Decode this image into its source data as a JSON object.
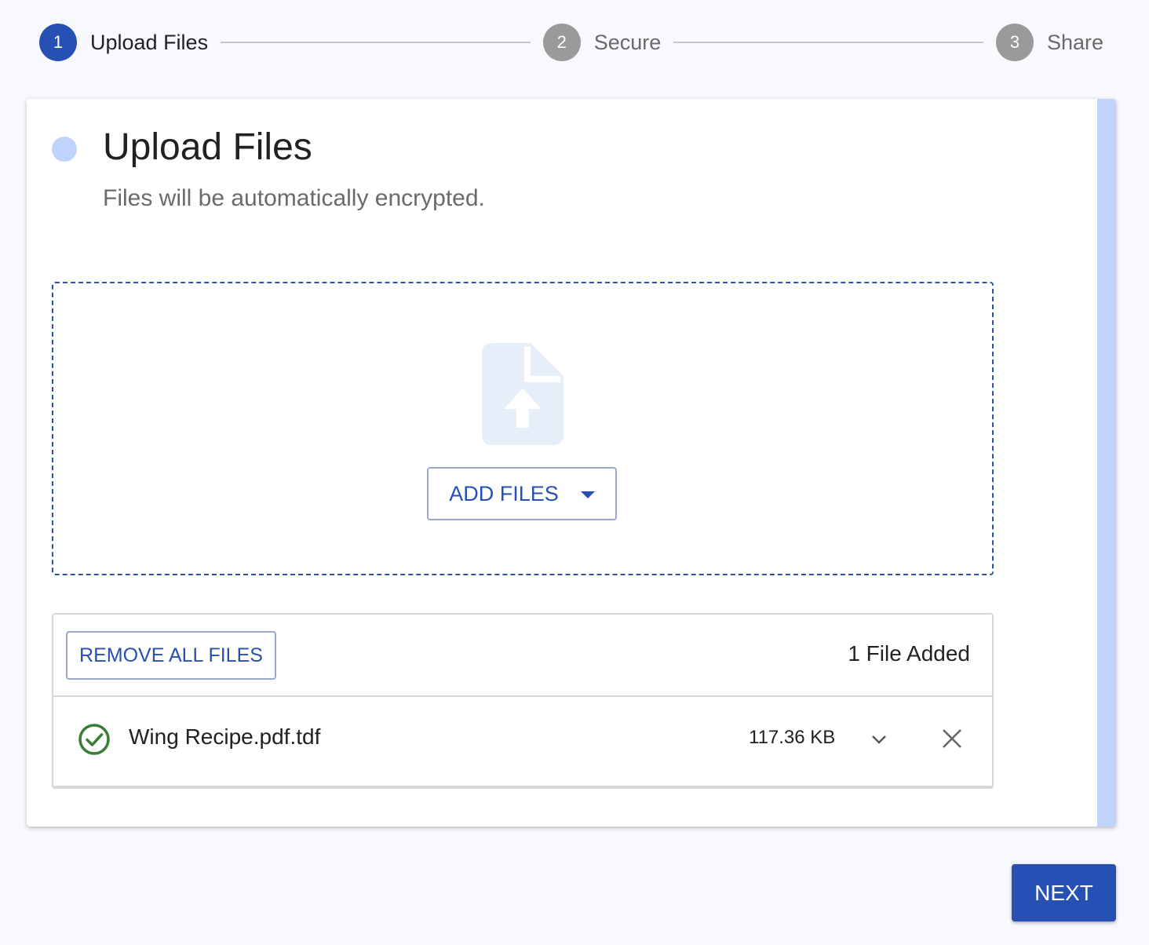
{
  "stepper": {
    "steps": [
      {
        "number": "1",
        "label": "Upload Files",
        "state": "active"
      },
      {
        "number": "2",
        "label": "Secure",
        "state": "inactive"
      },
      {
        "number": "3",
        "label": "Share",
        "state": "inactive"
      }
    ]
  },
  "card": {
    "title": "Upload Files",
    "subtitle": "Files will be automatically encrypted."
  },
  "dropzone": {
    "icon": "file-upload-icon",
    "add_files_label": "ADD FILES",
    "add_files_icon": "caret-down-icon"
  },
  "file_list": {
    "remove_all_label": "REMOVE ALL FILES",
    "count_text": "1 File Added",
    "files": [
      {
        "name": "Wing Recipe.pdf.tdf",
        "size": "117.36 KB",
        "status_icon": "check-circle-icon",
        "expand_icon": "chevron-down-icon",
        "remove_icon": "close-icon"
      }
    ]
  },
  "footer": {
    "next_label": "NEXT"
  },
  "colors": {
    "primary": "#2650b4",
    "accent_light": "#c0d3fb",
    "success": "#3a7d35",
    "inactive_step": "#9a9a9a"
  }
}
